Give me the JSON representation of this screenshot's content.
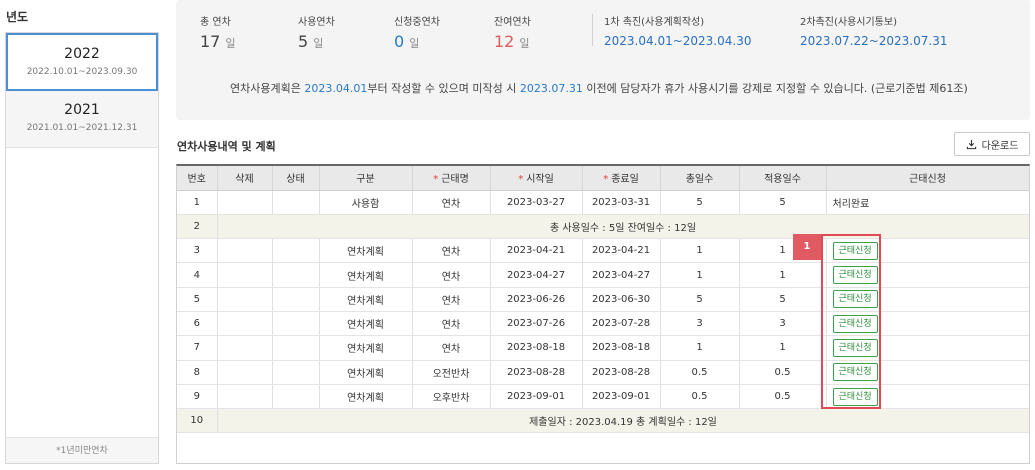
{
  "left": {
    "title": "년도",
    "years": [
      {
        "year": "2022",
        "range": "2022.10.01~2023.09.30"
      },
      {
        "year": "2021",
        "range": "2021.01.01~2021.12.31"
      }
    ],
    "footer": "*1년미만연차"
  },
  "summary": {
    "total": {
      "label": "총 연차",
      "value": "17",
      "unit": "일"
    },
    "used": {
      "label": "사용연차",
      "value": "5",
      "unit": "일"
    },
    "pending": {
      "label": "신청중연차",
      "value": "0",
      "unit": "일"
    },
    "remaining": {
      "label": "잔여연차",
      "value": "12",
      "unit": "일"
    },
    "first_notice": {
      "label": "1차 촉진(사용계획작성)",
      "date": "2023.04.01~2023.04.30"
    },
    "second_notice": {
      "label": "2차촉진(사용시기통보)",
      "date": "2023.07.22~2023.07.31"
    },
    "notice": {
      "p1": "연차사용계획은 ",
      "d1": "2023.04.01",
      "p2": "부터 작성할 수 있으며 미작성 시 ",
      "d2": "2023.07.31",
      "p3": " 이전에 담당자가 휴가 사용시기를 강제로 지정할 수 있습니다. (근로기준법 제61조)"
    }
  },
  "section": {
    "title": "연차사용내역 및 계획",
    "download_label": "다운로드"
  },
  "table": {
    "headers": [
      "번호",
      "삭제",
      "상태",
      "구분",
      "근태명",
      "시작일",
      "종료일",
      "총일수",
      "적용일수",
      "근태신청"
    ],
    "rows": [
      {
        "no": "1",
        "type": "사용함",
        "name": "연차",
        "start": "2023-03-27",
        "end": "2023-03-31",
        "total": "5",
        "applied": "5",
        "status_text": "처리완료"
      },
      {
        "no": "2",
        "summary": "총 사용일수 : 5일  잔여일수 : 12일"
      },
      {
        "no": "3",
        "type": "연차계획",
        "name": "연차",
        "start": "2023-04-21",
        "end": "2023-04-21",
        "total": "1",
        "applied": "1",
        "button": "근태신청"
      },
      {
        "no": "4",
        "type": "연차계획",
        "name": "연차",
        "start": "2023-04-27",
        "end": "2023-04-27",
        "total": "1",
        "applied": "1",
        "button": "근태신청"
      },
      {
        "no": "5",
        "type": "연차계획",
        "name": "연차",
        "start": "2023-06-26",
        "end": "2023-06-30",
        "total": "5",
        "applied": "5",
        "button": "근태신청"
      },
      {
        "no": "6",
        "type": "연차계획",
        "name": "연차",
        "start": "2023-07-26",
        "end": "2023-07-28",
        "total": "3",
        "applied": "3",
        "button": "근태신청"
      },
      {
        "no": "7",
        "type": "연차계획",
        "name": "연차",
        "start": "2023-08-18",
        "end": "2023-08-18",
        "total": "1",
        "applied": "1",
        "button": "근태신청"
      },
      {
        "no": "8",
        "type": "연차계획",
        "name": "오전반차",
        "start": "2023-08-28",
        "end": "2023-08-28",
        "total": "0.5",
        "applied": "0.5",
        "button": "근태신청"
      },
      {
        "no": "9",
        "type": "연차계획",
        "name": "오후반차",
        "start": "2023-09-01",
        "end": "2023-09-01",
        "total": "0.5",
        "applied": "0.5",
        "button": "근태신청"
      },
      {
        "no": "10",
        "summary": "제출일자 : 2023.04.19  총 계획일수 : 12일"
      }
    ]
  },
  "annotation": {
    "marker": "1"
  },
  "colors": {
    "accent_blue": "#2a7ac7",
    "remaining_red": "#e05a5a",
    "apply_green": "#2e8c3c",
    "highlight_red": "#e04a55"
  }
}
